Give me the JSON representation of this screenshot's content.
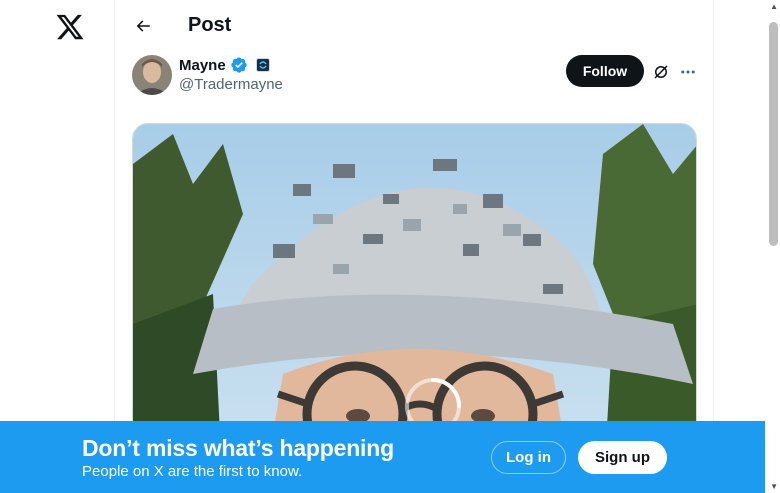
{
  "nav": {
    "logo_icon": "x-logo-icon",
    "back_icon": "arrow-left-icon"
  },
  "header": {
    "title": "Post"
  },
  "post": {
    "author_name": "Mayne",
    "author_handle": "@Tradermayne",
    "verified_icon": "verified-badge-icon",
    "affiliation_icon": "affiliation-badge-icon",
    "follow_label": "Follow",
    "grok_icon": "grok-icon",
    "more_icon": "more-horizontal-icon",
    "media_loading_icon": "loading-spinner-icon"
  },
  "banner": {
    "title": "Don’t miss what’s happening",
    "subtitle": "People on X are the first to know.",
    "login_label": "Log in",
    "signup_label": "Sign up"
  },
  "colors": {
    "brand_blue": "#1d9bf0",
    "text_primary": "#0f1419",
    "text_secondary": "#536471"
  }
}
